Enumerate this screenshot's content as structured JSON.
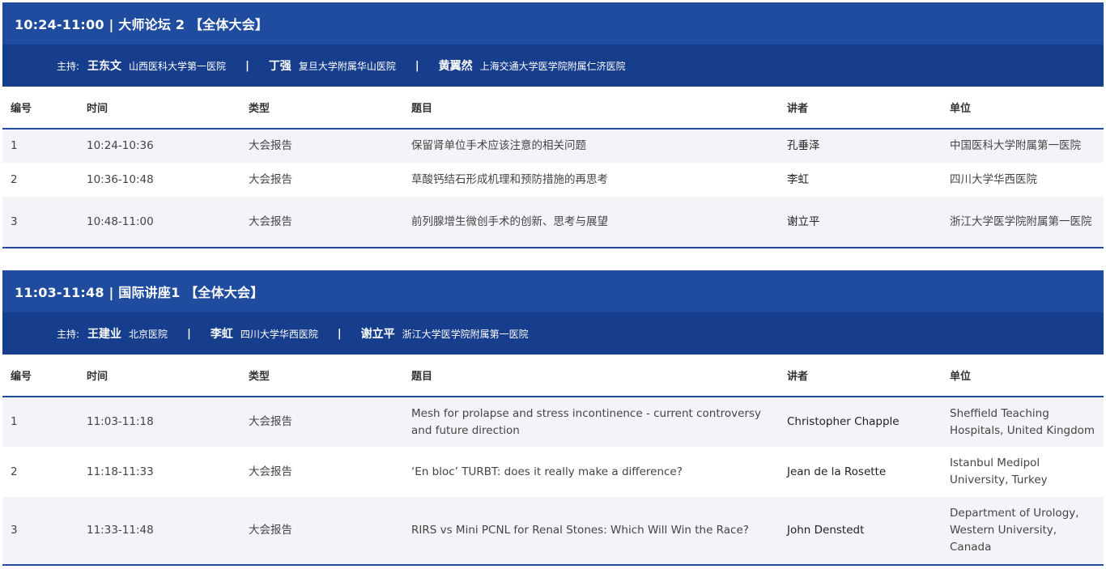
{
  "sessions": [
    {
      "title": "10:24-11:00 | 大师论坛 2 【全体大会】",
      "host_label": "主持:",
      "hosts": [
        {
          "name": "王东文",
          "org": "山西医科大学第一医院"
        },
        {
          "name": "丁强",
          "org": "复旦大学附属华山医院"
        },
        {
          "name": "黄翼然",
          "org": "上海交通大学医学院附属仁济医院"
        }
      ],
      "separator": "|",
      "columns": [
        "编号",
        "时间",
        "类型",
        "题目",
        "讲者",
        "单位"
      ],
      "rows": [
        {
          "no": "1",
          "time": "10:24-10:36",
          "type": "大会报告",
          "topic": "保留肾单位手术应该注意的相关问题",
          "speaker": "孔垂泽",
          "unit": "中国医科大学附属第一医院"
        },
        {
          "no": "2",
          "time": "10:36-10:48",
          "type": "大会报告",
          "topic": "草酸钙结石形成机理和预防措施的再思考",
          "speaker": "李虹",
          "unit": "四川大学华西医院"
        },
        {
          "no": "3",
          "time": "10:48-11:00",
          "type": "大会报告",
          "topic": "前列腺增生微创手术的创新、思考与展望",
          "speaker": "谢立平",
          "unit": "浙江大学医学院附属第一医院"
        }
      ]
    },
    {
      "title": "11:03-11:48 | 国际讲座1 【全体大会】",
      "host_label": "主持:",
      "hosts": [
        {
          "name": "王建业",
          "org": "北京医院"
        },
        {
          "name": "李虹",
          "org": "四川大学华西医院"
        },
        {
          "name": "谢立平",
          "org": "浙江大学医学院附属第一医院"
        }
      ],
      "separator": "|",
      "columns": [
        "编号",
        "时间",
        "类型",
        "题目",
        "讲者",
        "单位"
      ],
      "rows": [
        {
          "no": "1",
          "time": "11:03-11:18",
          "type": "大会报告",
          "topic": "Mesh for prolapse and stress incontinence - current controversy and future direction",
          "speaker": "Christopher Chapple",
          "unit": "Sheffield Teaching Hospitals, United Kingdom"
        },
        {
          "no": "2",
          "time": "11:18-11:33",
          "type": "大会报告",
          "topic": "‘En bloc’ TURBT: does it really make a difference?",
          "speaker": "Jean de la Rosette",
          "unit": "Istanbul Medipol University, Turkey"
        },
        {
          "no": "3",
          "time": "11:33-11:48",
          "type": "大会报告",
          "topic": "RIRS vs Mini PCNL for Renal Stones: Which Will Win the Race?",
          "speaker": "John Denstedt",
          "unit": "Department of Urology, Western University, Canada"
        }
      ]
    }
  ],
  "colors": {
    "header_bg": "#1f4c9e",
    "hosts_bg": "#163e8c",
    "row_alt_bg": "#f2f4f7",
    "rule": "#1f4c9e"
  }
}
